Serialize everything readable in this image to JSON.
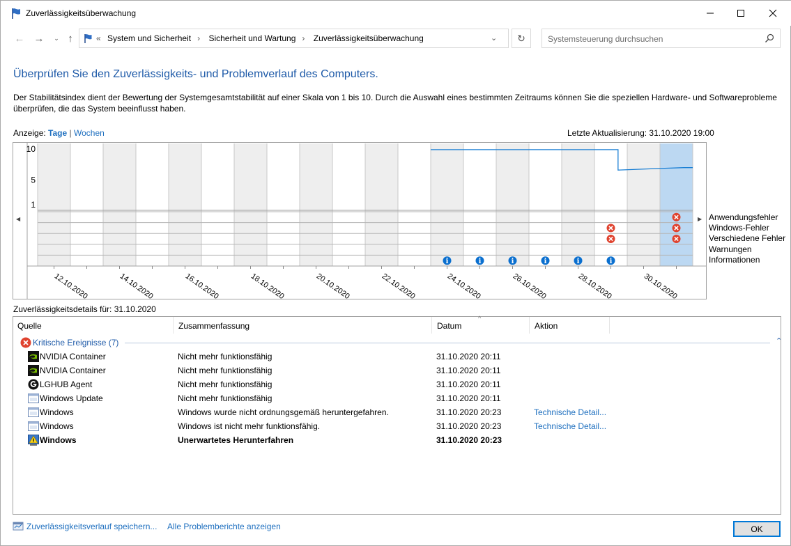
{
  "window": {
    "title": "Zuverlässigkeitsüberwachung"
  },
  "nav": {
    "crumb_prefix": "«",
    "crumbs": [
      "System und Sicherheit",
      "Sicherheit und Wartung",
      "Zuverlässigkeitsüberwachung"
    ],
    "search_placeholder": "Systemsteuerung durchsuchen"
  },
  "heading": "Überprüfen Sie den Zuverlässigkeits- und Problemverlauf des Computers.",
  "description": "Der Stabilitätsindex dient der Bewertung der Systemgesamtstabilität auf einer Skala von 1 bis 10. Durch die Auswahl eines bestimmten Zeitraums können Sie die speziellen Hardware- und Softwareprobleme überprüfen, die das System beeinflusst haben.",
  "view": {
    "label": "Anzeige:",
    "days": "Tage",
    "separator": "|",
    "weeks": "Wochen"
  },
  "last_update": "Letzte Aktualisierung: 31.10.2020 19:00",
  "chart_data": {
    "type": "line",
    "y_ticks": [
      "10",
      "5",
      "1"
    ],
    "ylim": [
      1,
      10
    ],
    "x_labels": [
      "12.10.2020",
      "14.10.2020",
      "16.10.2020",
      "18.10.2020",
      "20.10.2020",
      "22.10.2020",
      "24.10.2020",
      "26.10.2020",
      "28.10.2020",
      "30.10.2020"
    ],
    "days": [
      "12.10.2020",
      "13.10.2020",
      "14.10.2020",
      "15.10.2020",
      "16.10.2020",
      "17.10.2020",
      "18.10.2020",
      "19.10.2020",
      "20.10.2020",
      "21.10.2020",
      "22.10.2020",
      "23.10.2020",
      "24.10.2020",
      "25.10.2020",
      "26.10.2020",
      "27.10.2020",
      "28.10.2020",
      "29.10.2020",
      "30.10.2020",
      "31.10.2020"
    ],
    "stability_series": {
      "x": [
        "24.10.2020",
        "25.10.2020",
        "26.10.2020",
        "27.10.2020",
        "28.10.2020",
        "29.10.2020",
        "29.10.2020",
        "30.10.2020",
        "31.10.2020"
      ],
      "y": [
        9.9,
        9.9,
        9.9,
        9.9,
        9.9,
        9.9,
        6.6,
        6.8,
        7.0
      ]
    },
    "selected_day": "31.10.2020",
    "event_rows": [
      "Anwendungsfehler",
      "Windows-Fehler",
      "Verschiedene Fehler",
      "Warnungen",
      "Informationen"
    ],
    "events": [
      {
        "row": "Anwendungsfehler",
        "day": "31.10.2020",
        "kind": "error"
      },
      {
        "row": "Windows-Fehler",
        "day": "29.10.2020",
        "kind": "error"
      },
      {
        "row": "Windows-Fehler",
        "day": "31.10.2020",
        "kind": "error"
      },
      {
        "row": "Verschiedene Fehler",
        "day": "29.10.2020",
        "kind": "error"
      },
      {
        "row": "Verschiedene Fehler",
        "day": "31.10.2020",
        "kind": "error"
      },
      {
        "row": "Informationen",
        "day": "24.10.2020",
        "kind": "info"
      },
      {
        "row": "Informationen",
        "day": "25.10.2020",
        "kind": "info"
      },
      {
        "row": "Informationen",
        "day": "26.10.2020",
        "kind": "info"
      },
      {
        "row": "Informationen",
        "day": "27.10.2020",
        "kind": "info"
      },
      {
        "row": "Informationen",
        "day": "28.10.2020",
        "kind": "info"
      },
      {
        "row": "Informationen",
        "day": "29.10.2020",
        "kind": "info"
      }
    ]
  },
  "details_label": "Zuverlässigkeitsdetails für: 31.10.2020",
  "table": {
    "columns": [
      "Quelle",
      "Zusammenfassung",
      "Datum",
      "Aktion"
    ],
    "group": "Kritische Ereignisse (7)",
    "rows": [
      {
        "icon": "nvidia-icon",
        "source": "NVIDIA Container",
        "summary": "Nicht mehr funktionsfähig",
        "date": "31.10.2020 20:11",
        "action": "",
        "bold": false
      },
      {
        "icon": "nvidia-icon",
        "source": "NVIDIA Container",
        "summary": "Nicht mehr funktionsfähig",
        "date": "31.10.2020 20:11",
        "action": "",
        "bold": false
      },
      {
        "icon": "lghub-icon",
        "source": "LGHUB Agent",
        "summary": "Nicht mehr funktionsfähig",
        "date": "31.10.2020 20:11",
        "action": "",
        "bold": false
      },
      {
        "icon": "window-app-icon",
        "source": "Windows Update",
        "summary": "Nicht mehr funktionsfähig",
        "date": "31.10.2020 20:11",
        "action": "",
        "bold": false
      },
      {
        "icon": "window-app-icon",
        "source": "Windows",
        "summary": "Windows wurde nicht ordnungsgemäß heruntergefahren.",
        "date": "31.10.2020 20:23",
        "action": "Technische Detail...",
        "bold": false
      },
      {
        "icon": "window-app-icon",
        "source": "Windows",
        "summary": "Windows ist nicht mehr funktionsfähig.",
        "date": "31.10.2020 20:23",
        "action": "Technische Detail...",
        "bold": false
      },
      {
        "icon": "shutdown-warning-icon",
        "source": "Windows",
        "summary": "Unerwartetes Herunterfahren",
        "date": "31.10.2020 20:23",
        "action": "",
        "bold": true
      }
    ]
  },
  "footer": {
    "save_link": "Zuverlässigkeitsverlauf speichern...",
    "reports_link": "Alle Problemberichte anzeigen",
    "ok": "OK"
  },
  "colors": {
    "accent": "#1e5aa8",
    "link": "#1e6fbf",
    "line": "#1a7fd4",
    "selected": "#bcd8f2",
    "error": "#e0432f",
    "info": "#0a6fcf"
  }
}
